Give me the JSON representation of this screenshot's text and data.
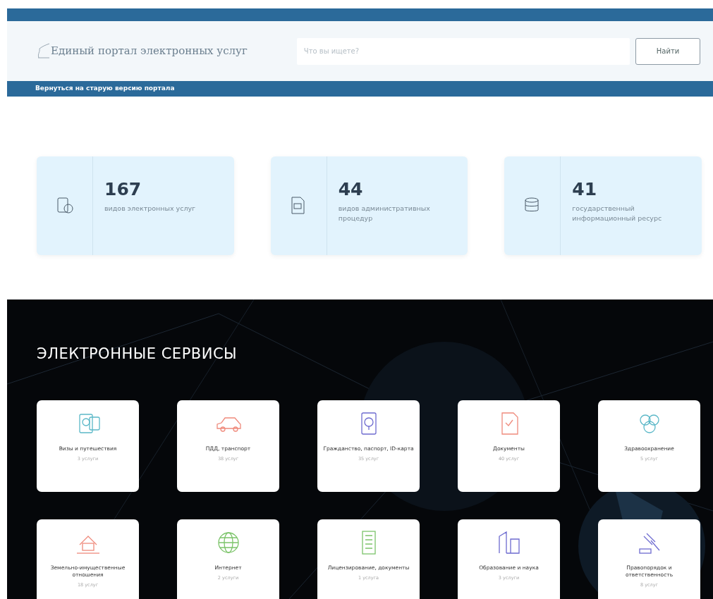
{
  "header": {
    "logo_text": "Единый портал электронных услуг",
    "search": {
      "placeholder": "Что вы ищете?"
    },
    "search_button": "Найти",
    "old_version_link": "Вернуться на старую версию портала"
  },
  "stats": [
    {
      "number": "167",
      "caption": "видов электронных услуг"
    },
    {
      "number": "44",
      "caption": "видов административных процедур"
    },
    {
      "number": "41",
      "caption": "государственный информационный ресурс"
    }
  ],
  "services": {
    "title": "ЭЛЕКТРОННЫЕ СЕРВИСЫ",
    "items": [
      {
        "title": "Визы и путешествия",
        "count": "3 услуги"
      },
      {
        "title": "ПДД, транспорт",
        "count": "38 услуг"
      },
      {
        "title": "Гражданство, паспорт, ID-карта",
        "count": "35 услуг"
      },
      {
        "title": "Документы",
        "count": "40 услуг"
      },
      {
        "title": "Здравоохранение",
        "count": "5 услуг"
      },
      {
        "title": "Земельно-имущественные отношения",
        "count": "18 услуг"
      },
      {
        "title": "Интернет",
        "count": "2 услуги"
      },
      {
        "title": "Лицензирование, документы",
        "count": "1 услуга"
      },
      {
        "title": "Образование и наука",
        "count": "3 услуги"
      },
      {
        "title": "Правопорядок и ответственность",
        "count": "8 услуг"
      }
    ]
  }
}
